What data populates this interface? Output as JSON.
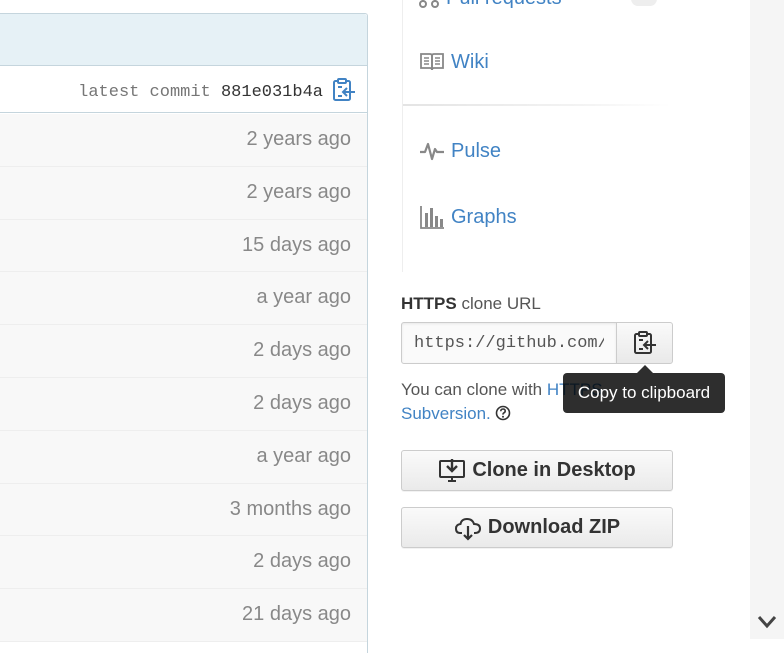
{
  "commit": {
    "label": "latest commit",
    "sha": "881e031b4a"
  },
  "files": [
    {
      "age": "2 years ago"
    },
    {
      "age": "2 years ago"
    },
    {
      "age": "15 days ago"
    },
    {
      "age": "a year ago"
    },
    {
      "age": "2 days ago"
    },
    {
      "age": "2 days ago"
    },
    {
      "age": "a year ago"
    },
    {
      "age": "3 months ago"
    },
    {
      "age": "2 days ago"
    },
    {
      "age": "21 days ago"
    }
  ],
  "nav": {
    "pull_requests": "Pull requests",
    "wiki": "Wiki",
    "pulse": "Pulse",
    "graphs": "Graphs"
  },
  "clone": {
    "protocol": "HTTPS",
    "title_suffix": "clone URL",
    "url": "https://github.com/g",
    "help_prefix": "You can clone with ",
    "help_link_https": "HTTPS",
    "help_link_subversion": "Subversion.",
    "tooltip": "Copy to clipboard"
  },
  "buttons": {
    "clone_desktop": "Clone in Desktop",
    "download_zip": "Download ZIP"
  },
  "colors": {
    "link": "#4183c4",
    "header_bg": "#e6f1f6",
    "border": "#c5d5dd"
  }
}
